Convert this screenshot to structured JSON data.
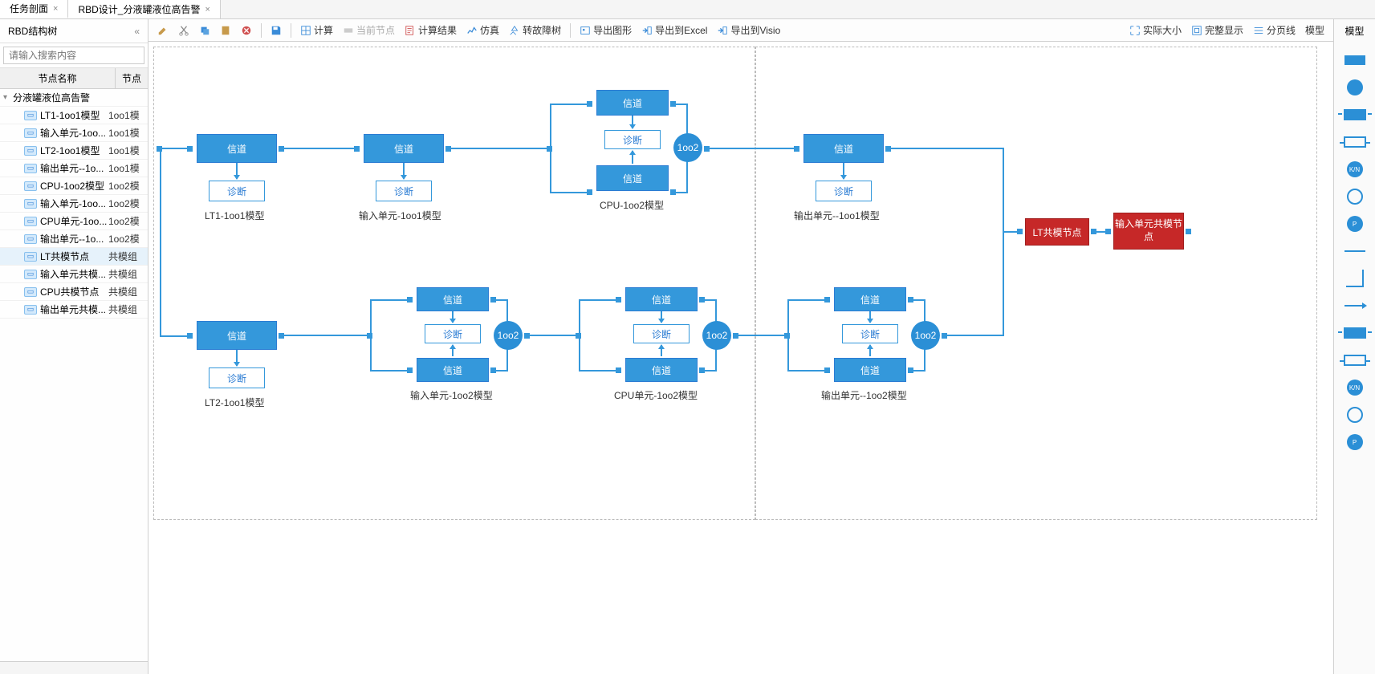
{
  "tabs": [
    {
      "label": "任务剖面",
      "active": true
    },
    {
      "label": "RBD设计_分液罐液位高告警",
      "active": false
    }
  ],
  "sidebar": {
    "title": "RBD结构树",
    "search_placeholder": "请输入搜索内容",
    "col_name": "节点名称",
    "col_type": "节点",
    "rows": [
      {
        "indent": 0,
        "caret": "▾",
        "icon": "",
        "name": "分液罐液位高告警",
        "type": ""
      },
      {
        "indent": 1,
        "caret": "",
        "icon": "1oo1",
        "name": "LT1-1oo1模型",
        "type": "1oo1模"
      },
      {
        "indent": 1,
        "caret": "",
        "icon": "1oo1",
        "name": "输入单元-1oo...",
        "type": "1oo1模"
      },
      {
        "indent": 1,
        "caret": "",
        "icon": "1oo1",
        "name": "LT2-1oo1模型",
        "type": "1oo1模"
      },
      {
        "indent": 1,
        "caret": "",
        "icon": "1oo1",
        "name": "输出单元--1o...",
        "type": "1oo1模"
      },
      {
        "indent": 1,
        "caret": "",
        "icon": "1oo2",
        "name": "CPU-1oo2模型",
        "type": "1oo2模"
      },
      {
        "indent": 1,
        "caret": "",
        "icon": "1oo2",
        "name": "输入单元-1oo...",
        "type": "1oo2模"
      },
      {
        "indent": 1,
        "caret": "",
        "icon": "1oo2",
        "name": "CPU单元-1oo...",
        "type": "1oo2模"
      },
      {
        "indent": 1,
        "caret": "",
        "icon": "1oo2",
        "name": "输出单元--1o...",
        "type": "1oo2模"
      },
      {
        "indent": 1,
        "caret": "",
        "icon": "ccf",
        "name": "LT共模节点",
        "type": "共模组",
        "selected": true
      },
      {
        "indent": 1,
        "caret": "",
        "icon": "ccf",
        "name": "输入单元共模...",
        "type": "共模组"
      },
      {
        "indent": 1,
        "caret": "",
        "icon": "ccf",
        "name": "CPU共模节点",
        "type": "共模组"
      },
      {
        "indent": 1,
        "caret": "",
        "icon": "ccf",
        "name": "输出单元共模...",
        "type": "共模组"
      }
    ]
  },
  "toolbar": {
    "calc": "计算",
    "current_node": "当前节点",
    "calc_result": "计算结果",
    "simulate": "仿真",
    "fault_tree": "转故障树",
    "export_image": "导出图形",
    "export_excel": "导出到Excel",
    "export_visio": "导出到Visio",
    "actual_size": "实际大小",
    "fit": "完整显示",
    "page_line": "分页线",
    "model": "模型"
  },
  "diagram": {
    "channel": "信道",
    "diagnosis": "诊断",
    "gate_1oo2": "1oo2",
    "lt1_label": "LT1-1oo1模型",
    "lt2_label": "LT2-1oo1模型",
    "input_1oo1_label": "输入单元-1oo1模型",
    "input_1oo2_label": "输入单元-1oo2模型",
    "cpu_1oo2_label": "CPU-1oo2模型",
    "cpu_unit_1oo2_label": "CPU单元-1oo2模型",
    "output_1oo1_label": "输出单元--1oo1模型",
    "output_1oo2_label": "输出单元--1oo2模型",
    "lt_common": "LT共模节点",
    "input_common": "输入单元共模节点"
  },
  "palette": {
    "title": "模型",
    "kn": "K/N",
    "p": "P"
  }
}
